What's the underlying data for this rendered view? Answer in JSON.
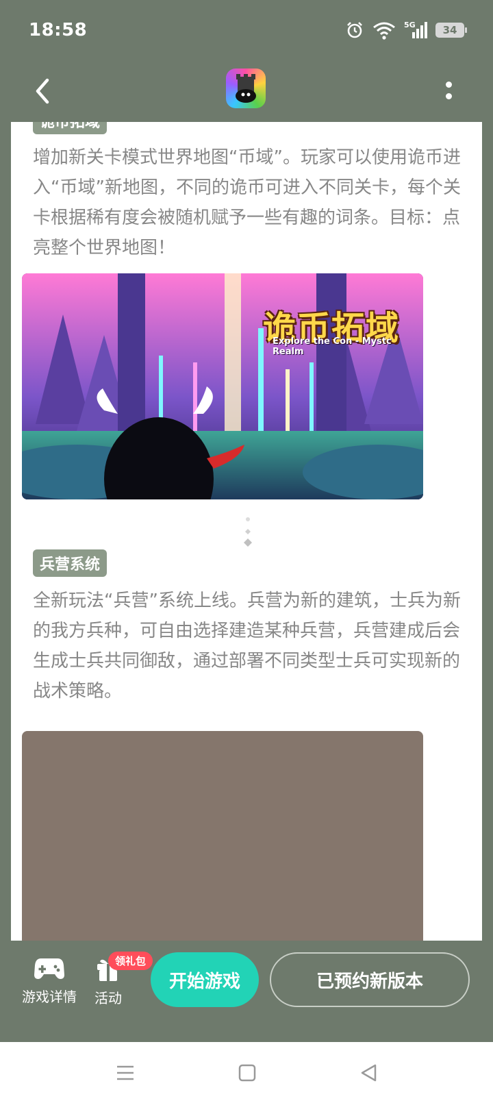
{
  "status_bar": {
    "time": "18:58",
    "network": "5G",
    "battery": "34"
  },
  "article": {
    "section1": {
      "tag": "诡币拓域",
      "body": "增加新关卡模式世界地图“币域”。玩家可以使用诡币进入“币域”新地图，不同的诡币可进入不同关卡，每个关卡根据稀有度会被随机赋予一些有趣的词条。目标：点亮整个世界地图！",
      "banner_title": "诡币拓域",
      "banner_subtitle": "Explore the Con - Mystc Realm"
    },
    "section2": {
      "tag": "兵营系统",
      "body": "全新玩法“兵营”系统上线。兵营为新的建筑，士兵为新的我方兵种，可自由选择建造某种兵营，兵营建成后会生成士兵共同御敌，通过部署不同类型士兵可实现新的战术策略。"
    }
  },
  "bottom_bar": {
    "details_label": "游戏详情",
    "activity_label": "活动",
    "gift_badge": "领礼包",
    "start_label": "开始游戏",
    "reserved_label": "已预约新版本"
  },
  "colors": {
    "accent": "#22d3b6",
    "bar": "#6e7a6c",
    "tag": "#8c9a89",
    "badge": "#ff4d5a"
  }
}
